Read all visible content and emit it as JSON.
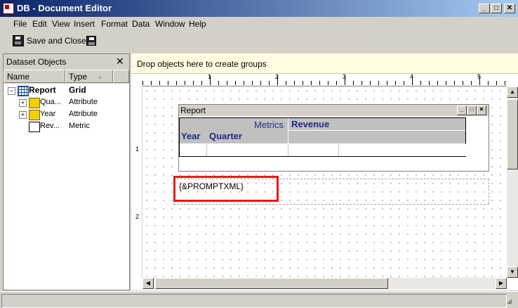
{
  "window": {
    "title": "DB - Document Editor",
    "minimize": "_",
    "maximize": "□",
    "close": "✕"
  },
  "menu": [
    {
      "label": "File"
    },
    {
      "label": "Edit"
    },
    {
      "label": "View"
    },
    {
      "label": "Insert"
    },
    {
      "label": "Format"
    },
    {
      "label": "Data"
    },
    {
      "label": "Window"
    },
    {
      "label": "Help"
    }
  ],
  "toolbar": {
    "save_close_label": "Save and Close"
  },
  "dataset_panel": {
    "title": "Dataset Objects",
    "close": "✕",
    "columns": {
      "name": "Name",
      "type": "Type"
    },
    "rows": [
      {
        "name": "Report",
        "type": "Grid",
        "expander": "−"
      },
      {
        "name": "Qua...",
        "type": "Attribute",
        "expander": "+"
      },
      {
        "name": "Year",
        "type": "Attribute",
        "expander": "+"
      },
      {
        "name": "Rev...",
        "type": "Metric",
        "expander": ""
      }
    ]
  },
  "group_bar": {
    "hint": "Drop objects here to create groups"
  },
  "ruler": {
    "labels": [
      "1",
      "2",
      "3",
      "4",
      "5"
    ],
    "vlabels": [
      "1",
      "2"
    ]
  },
  "report": {
    "title": "Report",
    "metrics_label": "Metrics",
    "revenue_label": "Revenue",
    "year_label": "Year",
    "quarter_label": "Quarter"
  },
  "prompt_text": "{&PROMPTXML}",
  "colors": {
    "title_start": "#0a246a",
    "highlight": "#e31b1b",
    "grid_header": "#1d2a8a"
  }
}
